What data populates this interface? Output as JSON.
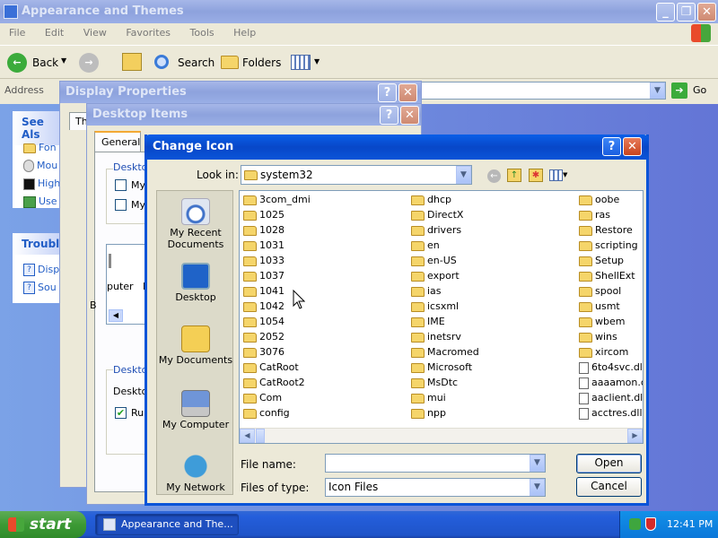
{
  "explorer": {
    "title": "Appearance and Themes",
    "menu": [
      "File",
      "Edit",
      "View",
      "Favorites",
      "Tools",
      "Help"
    ],
    "toolbar": {
      "back": "Back",
      "search": "Search",
      "folders": "Folders"
    },
    "address_label": "Address",
    "go": "Go",
    "see_also": {
      "title": "See Als",
      "items": [
        "Fon",
        "Mou",
        "High",
        "Use"
      ]
    },
    "troubleshoot": {
      "title": "Trouble",
      "items": [
        "Disp",
        "Sou"
      ]
    }
  },
  "display_properties": {
    "title": "Display Properties",
    "tab_partial": "Th"
  },
  "desktop_items": {
    "title": "Desktop Items",
    "tab": "General",
    "group1": "Deskto",
    "check1": "My",
    "check2": "My",
    "list_frag1": "puter",
    "list_frag2": "M",
    "b_frag": "B",
    "group2": "Deskto",
    "label2": "Deskto",
    "check3": "Ru"
  },
  "change_icon": {
    "title": "Change Icon",
    "look_in_label": "Look in:",
    "look_in_value": "system32",
    "places": [
      "My Recent Documents",
      "Desktop",
      "My Documents",
      "My Computer",
      "My Network"
    ],
    "col1": [
      "3com_dmi",
      "1025",
      "1028",
      "1031",
      "1033",
      "1037",
      "1041",
      "1042",
      "1054",
      "2052",
      "3076",
      "CatRoot",
      "CatRoot2",
      "Com",
      "config"
    ],
    "col2": [
      "dhcp",
      "DirectX",
      "drivers",
      "en",
      "en-US",
      "export",
      "ias",
      "icsxml",
      "IME",
      "inetsrv",
      "Macromed",
      "Microsoft",
      "MsDtc",
      "mui",
      "npp"
    ],
    "col3": [
      {
        "name": "oobe",
        "type": "folder"
      },
      {
        "name": "ras",
        "type": "folder"
      },
      {
        "name": "Restore",
        "type": "folder"
      },
      {
        "name": "scripting",
        "type": "folder"
      },
      {
        "name": "Setup",
        "type": "folder"
      },
      {
        "name": "ShellExt",
        "type": "folder"
      },
      {
        "name": "spool",
        "type": "folder"
      },
      {
        "name": "usmt",
        "type": "folder"
      },
      {
        "name": "wbem",
        "type": "folder"
      },
      {
        "name": "wins",
        "type": "folder"
      },
      {
        "name": "xircom",
        "type": "folder"
      },
      {
        "name": "6to4svc.dll",
        "type": "dll"
      },
      {
        "name": "aaaamon.c",
        "type": "dll"
      },
      {
        "name": "aaclient.dll",
        "type": "dll"
      },
      {
        "name": "acctres.dll",
        "type": "dll"
      }
    ],
    "file_name_label": "File name:",
    "file_name_value": "",
    "files_of_type_label": "Files of type:",
    "files_of_type_value": "Icon Files",
    "open": "Open",
    "cancel": "Cancel"
  },
  "taskbar": {
    "start": "start",
    "task": "Appearance and The...",
    "clock": "12:41 PM"
  }
}
